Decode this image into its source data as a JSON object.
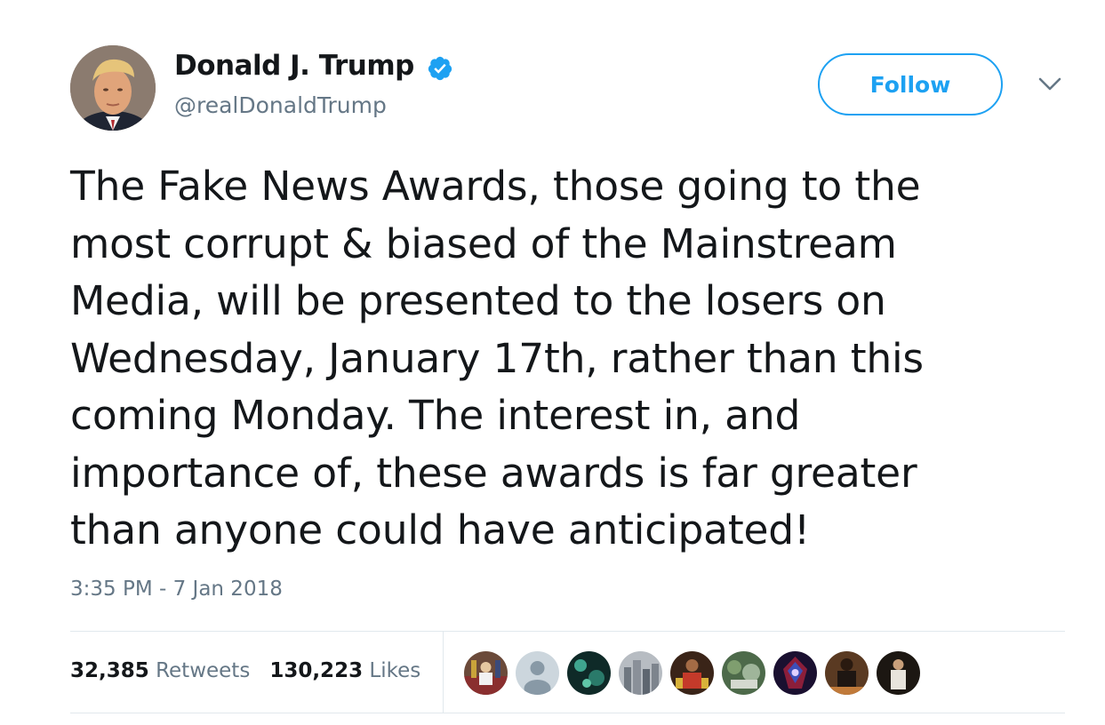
{
  "author": {
    "name": "Donald J. Trump",
    "handle": "@realDonaldTrump",
    "verified": true,
    "avatar_icon": "profile-photo"
  },
  "follow_button": {
    "label": "Follow",
    "color": "#1da1f2"
  },
  "menu": {
    "icon": "chevron-down-icon"
  },
  "tweet": {
    "text": "The Fake News Awards, those going to the\nmost corrupt & biased of the Mainstream\nMedia, will be presented to the losers on\nWednesday, January 17th, rather than this\ncoming Monday. The interest in, and\nimportance of, these awards is far greater\nthan anyone could have anticipated!",
    "timestamp": "3:35 PM - 7 Jan 2018"
  },
  "stats": {
    "retweets_count": "32,385",
    "retweets_label": "Retweets",
    "likes_count": "130,223",
    "likes_label": "Likes"
  },
  "colors": {
    "secondary_text": "#657786",
    "divider": "#e1e8ed",
    "text": "#14171a"
  }
}
